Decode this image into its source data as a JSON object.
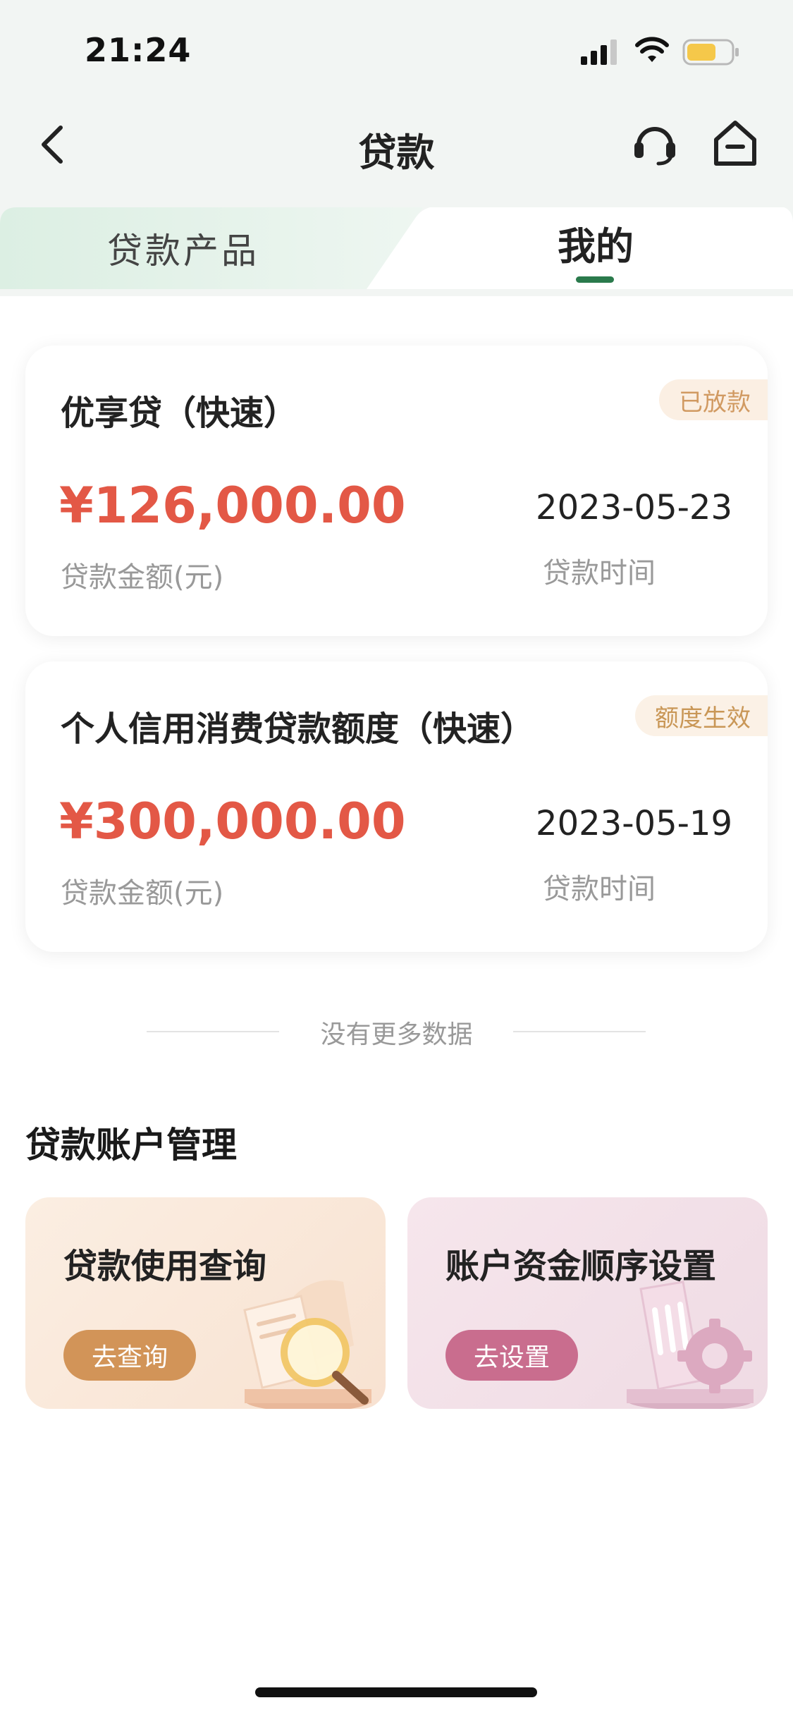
{
  "status_bar": {
    "time": "21:24",
    "signal_icon": "cellular-signal-icon",
    "wifi_icon": "wifi-icon",
    "battery_icon": "battery-icon",
    "battery_color": "#f5c84a"
  },
  "nav": {
    "title": "贷款",
    "back_icon": "chevron-left-icon",
    "service_icon": "headset-icon",
    "home_icon": "home-icon"
  },
  "tabs": [
    {
      "label": "贷款产品",
      "active": false
    },
    {
      "label": "我的",
      "active": true
    }
  ],
  "loans": [
    {
      "name": "优享贷（快速）",
      "status": "已放款",
      "status_color": "#d19a62",
      "status_bg": "#fbefe3",
      "amount": "¥126,000.00",
      "amount_label": "贷款金额(元)",
      "date": "2023-05-23",
      "date_label": "贷款时间"
    },
    {
      "name": "个人信用消费贷款额度（快速）",
      "status": "额度生效",
      "status_color": "#c99757",
      "status_bg": "#fbf1e6",
      "amount": "¥300,000.00",
      "amount_label": "贷款金额(元)",
      "date": "2023-05-19",
      "date_label": "贷款时间"
    }
  ],
  "no_more_text": "没有更多数据",
  "management": {
    "title": "贷款账户管理",
    "cards": [
      {
        "title": "贷款使用查询",
        "button": "去查询",
        "icon": "magnifier-document-icon"
      },
      {
        "title": "账户资金顺序设置",
        "button": "去设置",
        "icon": "phone-gear-icon"
      }
    ]
  },
  "colors": {
    "accent_green": "#2a7a4c",
    "amount_red": "#e35846"
  }
}
